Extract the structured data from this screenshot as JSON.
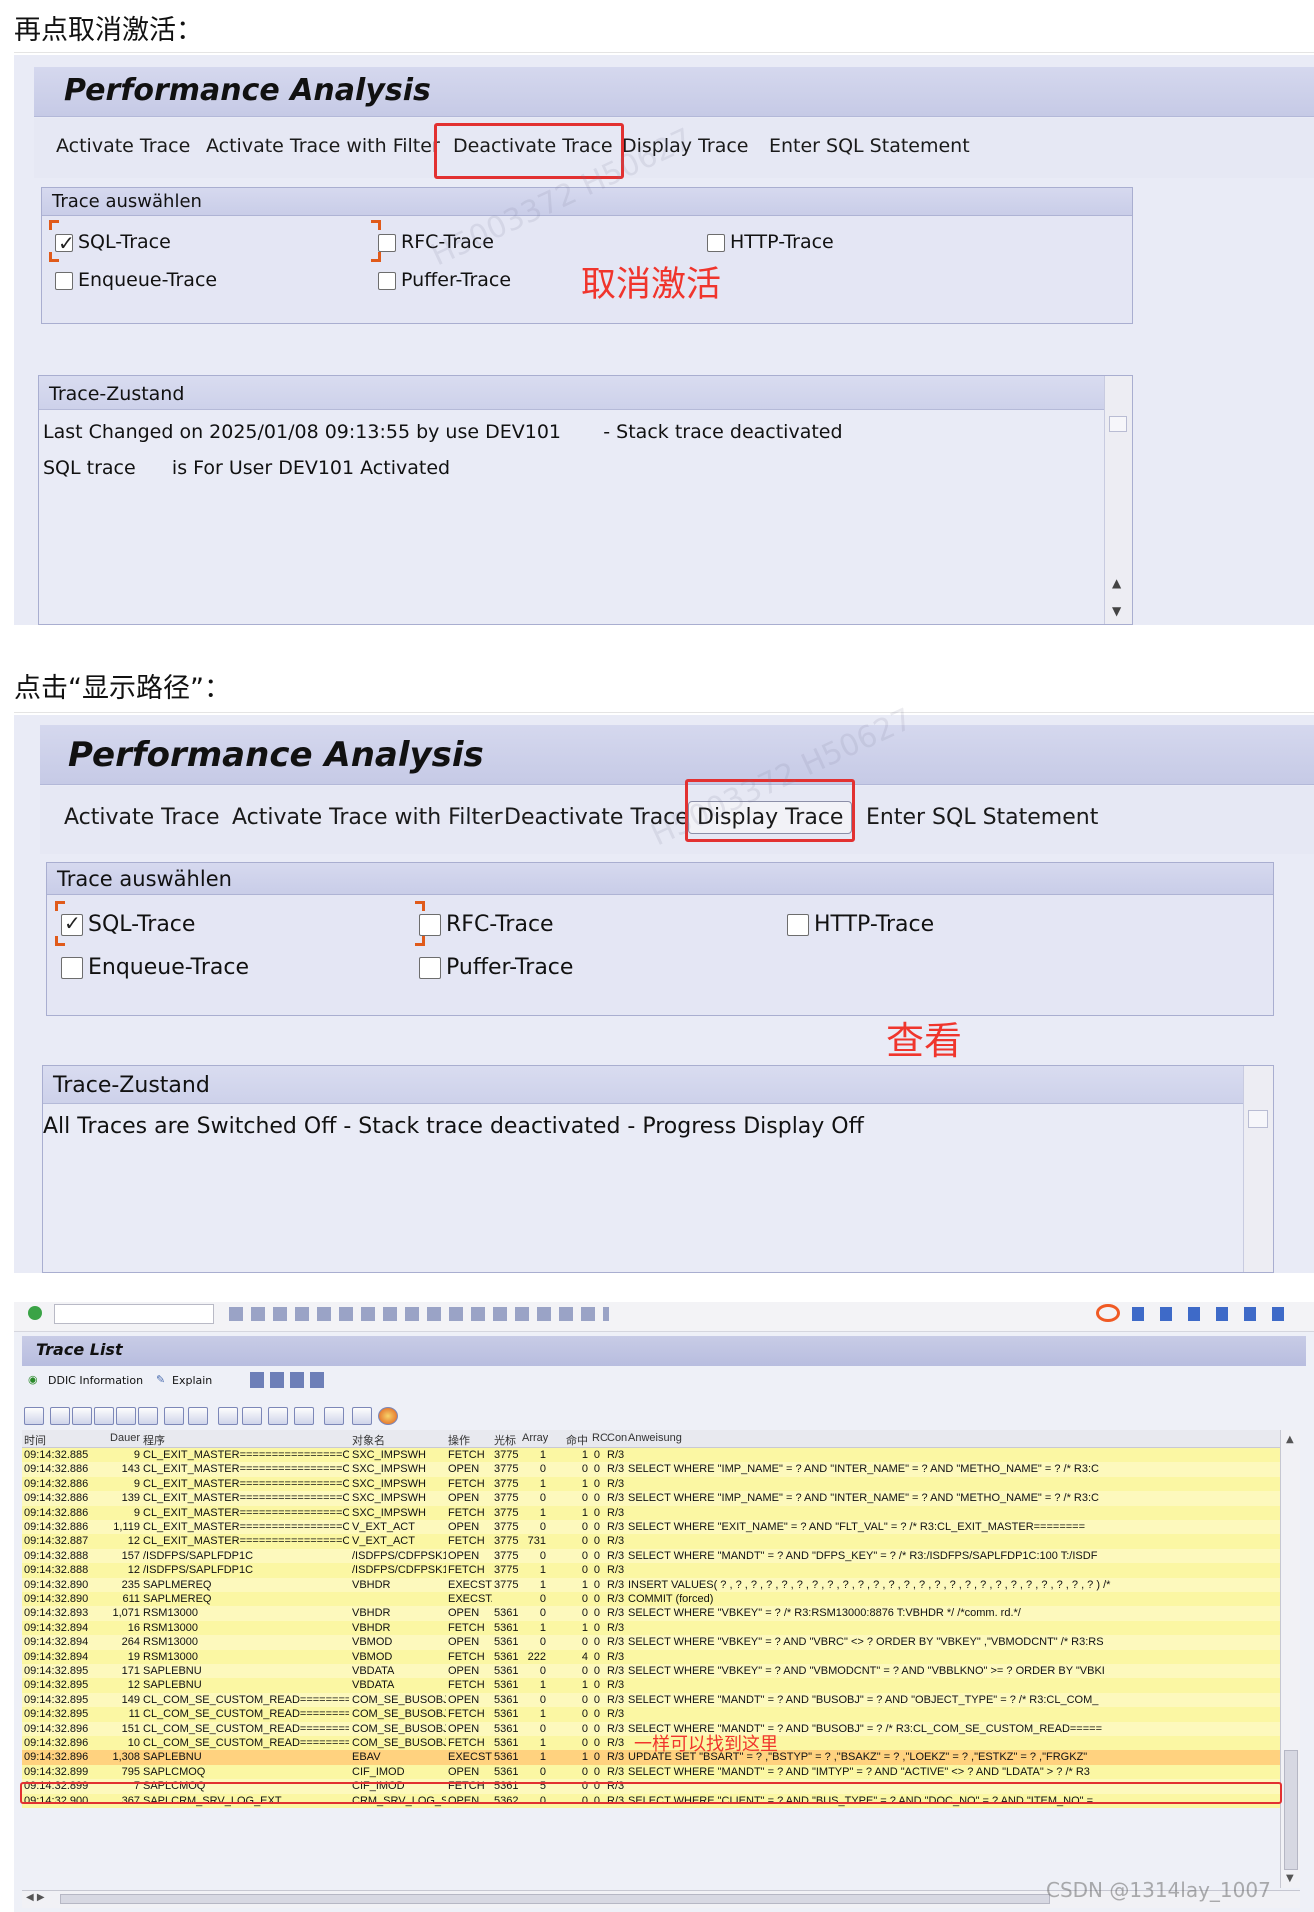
{
  "captions": {
    "first": "再点取消激活：",
    "second": "点击“显示路径”：",
    "csdn": "CSDN @1314lay_1007"
  },
  "screen1": {
    "title": "Performance Analysis",
    "menu": [
      "Activate Trace",
      "Activate Trace with Filter",
      "Deactivate Trace",
      "Display Trace",
      "Enter SQL Statement"
    ],
    "group_title": "Trace auswählen",
    "checkboxes": [
      {
        "label": "SQL-Trace",
        "checked": true
      },
      {
        "label": "RFC-Trace",
        "checked": false
      },
      {
        "label": "HTTP-Trace",
        "checked": false
      },
      {
        "label": "Enqueue-Trace",
        "checked": false
      },
      {
        "label": "Puffer-Trace",
        "checked": false
      }
    ],
    "annotation": "取消激活",
    "panel_title": "Trace-Zustand",
    "status_line1": "Last Changed on 2025/01/08 09:13:55 by use DEV101       - Stack trace deactivated",
    "status_line2": "SQL trace      is For User DEV101 Activated"
  },
  "screen2": {
    "title": "Performance Analysis",
    "menu": [
      "Activate Trace",
      "Activate Trace with Filter",
      "Deactivate Trace",
      "Display Trace",
      "Enter SQL Statement"
    ],
    "group_title": "Trace auswählen",
    "checkboxes": [
      {
        "label": "SQL-Trace",
        "checked": true
      },
      {
        "label": "RFC-Trace",
        "checked": false
      },
      {
        "label": "HTTP-Trace",
        "checked": false
      },
      {
        "label": "Enqueue-Trace",
        "checked": false
      },
      {
        "label": "Puffer-Trace",
        "checked": false
      }
    ],
    "annotation": "查看",
    "panel_title": "Trace-Zustand",
    "status_line1": "All Traces are Switched Off - Stack trace deactivated - Progress Display Off"
  },
  "trace_list": {
    "title": "Trace List",
    "toolbar": {
      "ddic": "DDIC Information",
      "explain": "Explain"
    },
    "annotation": "一样可以找到这里",
    "headers": [
      "时间",
      "Dauer",
      "程序",
      "对象名",
      "操作",
      "光标",
      "Array",
      "命中",
      "RC",
      "Con",
      "Anweisung"
    ],
    "rows": [
      [
        "09:14:32.885",
        "9",
        "CL_EXIT_MASTER================CP",
        "SXC_IMPSWH",
        "FETCH",
        "3775",
        "1",
        "1",
        "0",
        "R/3",
        ""
      ],
      [
        "09:14:32.886",
        "143",
        "CL_EXIT_MASTER================CP",
        "SXC_IMPSWH",
        "OPEN",
        "3775",
        "0",
        "0",
        "0",
        "R/3",
        "SELECT WHERE \"IMP_NAME\" = ? AND \"INTER_NAME\" = ? AND \"METHO_NAME\" = ?  /* R3:C"
      ],
      [
        "09:14:32.886",
        "9",
        "CL_EXIT_MASTER================CP",
        "SXC_IMPSWH",
        "FETCH",
        "3775",
        "1",
        "1",
        "0",
        "R/3",
        ""
      ],
      [
        "09:14:32.886",
        "139",
        "CL_EXIT_MASTER================CP",
        "SXC_IMPSWH",
        "OPEN",
        "3775",
        "0",
        "0",
        "0",
        "R/3",
        "SELECT WHERE \"IMP_NAME\" = ? AND \"INTER_NAME\" = ? AND \"METHO_NAME\" = ?  /* R3:C"
      ],
      [
        "09:14:32.886",
        "9",
        "CL_EXIT_MASTER================CP",
        "SXC_IMPSWH",
        "FETCH",
        "3775",
        "1",
        "1",
        "0",
        "R/3",
        ""
      ],
      [
        "09:14:32.886",
        "1,119",
        "CL_EXIT_MASTER================CP",
        "V_EXT_ACT",
        "OPEN",
        "3775",
        "0",
        "0",
        "0",
        "R/3",
        "SELECT WHERE \"EXIT_NAME\" = ? AND \"FLT_VAL\" = ?  /* R3:CL_EXIT_MASTER========"
      ],
      [
        "09:14:32.887",
        "12",
        "CL_EXIT_MASTER================CP",
        "V_EXT_ACT",
        "FETCH",
        "3775",
        "731",
        "0",
        "0",
        "R/3",
        ""
      ],
      [
        "09:14:32.888",
        "157",
        "/ISDFPS/SAPLFDP1C",
        "/ISDFPS/CDFPSK1",
        "OPEN",
        "3775",
        "0",
        "0",
        "0",
        "R/3",
        "SELECT WHERE \"MANDT\" = ? AND \"DFPS_KEY\" = ?  /* R3:/ISDFPS/SAPLFDP1C:100 T:/ISDF"
      ],
      [
        "09:14:32.888",
        "12",
        "/ISDFPS/SAPLFDP1C",
        "/ISDFPS/CDFPSK1",
        "FETCH",
        "3775",
        "1",
        "0",
        "0",
        "R/3",
        ""
      ],
      [
        "09:14:32.890",
        "235",
        "SAPLMEREQ",
        "VBHDR",
        "EXECSTM",
        "3775",
        "1",
        "1",
        "0",
        "R/3",
        "INSERT  VALUES( ? , ? , ? , ? , ? , ? , ? , ? , ? , ? , ? , ? , ? , ? , ? , ? , ? , ? , ? , ? , ? , ? , ? , ? , ? )  /*"
      ],
      [
        "09:14:32.890",
        "611",
        "SAPLMEREQ",
        "",
        "EXECSTA",
        "",
        "0",
        "0",
        "0",
        "R/3",
        "COMMIT (forced)"
      ],
      [
        "09:14:32.893",
        "1,071",
        "RSM13000",
        "VBHDR",
        "OPEN",
        "5361",
        "0",
        "0",
        "0",
        "R/3",
        "SELECT WHERE \"VBKEY\" = ? /* R3:RSM13000:8876 T:VBHDR */  /*comm. rd.*/"
      ],
      [
        "09:14:32.894",
        "16",
        "RSM13000",
        "VBHDR",
        "FETCH",
        "5361",
        "1",
        "1",
        "0",
        "R/3",
        ""
      ],
      [
        "09:14:32.894",
        "264",
        "RSM13000",
        "VBMOD",
        "OPEN",
        "5361",
        "0",
        "0",
        "0",
        "R/3",
        "SELECT WHERE \"VBKEY\" = ? AND \"VBRC\" <> ? ORDER BY \"VBKEY\" ,\"VBMODCNT\"  /* R3:RS"
      ],
      [
        "09:14:32.894",
        "19",
        "RSM13000",
        "VBMOD",
        "FETCH",
        "5361",
        "222",
        "4",
        "0",
        "R/3",
        ""
      ],
      [
        "09:14:32.895",
        "171",
        "SAPLEBNU",
        "VBDATA",
        "OPEN",
        "5361",
        "0",
        "0",
        "0",
        "R/3",
        "SELECT WHERE \"VBKEY\" = ? AND \"VBMODCNT\" = ? AND \"VBBLKNO\" >= ? ORDER BY \"VBKI"
      ],
      [
        "09:14:32.895",
        "12",
        "SAPLEBNU",
        "VBDATA",
        "FETCH",
        "5361",
        "1",
        "1",
        "0",
        "R/3",
        ""
      ],
      [
        "09:14:32.895",
        "149",
        "CL_COM_SE_CUSTOM_READ=========CP",
        "COM_SE_BUSOBJTY",
        "OPEN",
        "5361",
        "0",
        "0",
        "0",
        "R/3",
        "SELECT WHERE \"MANDT\" = ? AND \"BUSOBJ\" = ? AND \"OBJECT_TYPE\" = ?  /* R3:CL_COM_"
      ],
      [
        "09:14:32.895",
        "11",
        "CL_COM_SE_CUSTOM_READ=========CP",
        "COM_SE_BUSOBJTY",
        "FETCH",
        "5361",
        "1",
        "0",
        "0",
        "R/3",
        ""
      ],
      [
        "09:14:32.896",
        "151",
        "CL_COM_SE_CUSTOM_READ=========CP",
        "COM_SE_BUSOBJ",
        "OPEN",
        "5361",
        "0",
        "0",
        "0",
        "R/3",
        "SELECT WHERE \"MANDT\" = ? AND \"BUSOBJ\" = ?  /* R3:CL_COM_SE_CUSTOM_READ====="
      ],
      [
        "09:14:32.896",
        "10",
        "CL_COM_SE_CUSTOM_READ=========CP",
        "COM_SE_BUSOBJ",
        "FETCH",
        "5361",
        "1",
        "0",
        "0",
        "R/3",
        ""
      ],
      [
        "09:14:32.896",
        "1,308",
        "SAPLEBNU",
        "EBAV",
        "EXECSTM",
        "5361",
        "1",
        "1",
        "0",
        "R/3",
        "UPDATE  SET \"BSART\" = ? ,\"BSTYP\" = ? ,\"BSAKZ\" = ? ,\"LOEKZ\" = ? ,\"ESTKZ\" = ? ,\"FRGKZ\""
      ],
      [
        "09:14:32.899",
        "795",
        "SAPLCMOQ",
        "CIF_IMOD",
        "OPEN",
        "5361",
        "0",
        "0",
        "0",
        "R/3",
        "SELECT WHERE \"MANDT\" = ? AND \"IMTYP\" = ? AND \"ACTIVE\" <> ? AND \"LDATA\" > ?  /* R3"
      ],
      [
        "09:14:32.899",
        "7",
        "SAPLCMOQ",
        "CIF_IMOD",
        "FETCH",
        "5361",
        "5",
        "0",
        "0",
        "R/3",
        ""
      ],
      [
        "09:14:32.900",
        "367",
        "SAPLCRM_SRV_LOG_EXT",
        "CRM_SRV_LOG_SC",
        "OPEN",
        "5362",
        "0",
        "0",
        "0",
        "R/3",
        "SELECT WHERE \"CLIENT\" = ? AND \"BUS_TYPE\" = ? AND \"DOC_NO\" = ? AND \"ITEM_NO\" ="
      ]
    ]
  }
}
